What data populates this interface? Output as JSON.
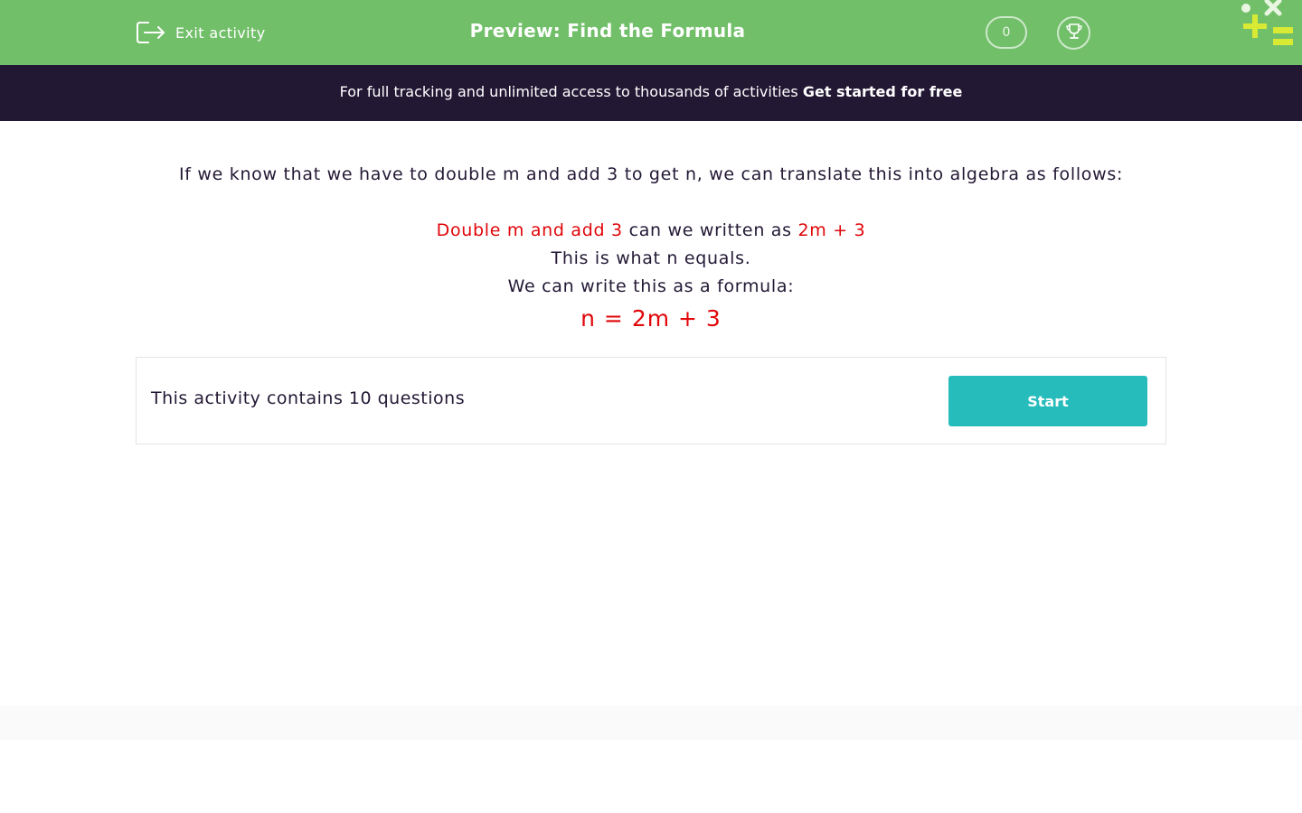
{
  "header": {
    "exit_label": "Exit activity",
    "title": "Preview: Find the Formula",
    "score": "0",
    "background": "#72bf6a"
  },
  "promo": {
    "text": "For full tracking and unlimited access to thousands of activities",
    "link": "Get started for free",
    "background": "#231834"
  },
  "explanation": {
    "intro": "If we know that we have to double m and add 3 to get n, we can translate this into algebra as follows:",
    "line1_red_a": "Double m and add 3",
    "line1_mid": "can we written as",
    "line1_red_b": "2m + 3",
    "line2": "This is what n equals.",
    "line3": "We can write this as a formula:",
    "formula": "n = 2m + 3",
    "highlight_color": "#e0060a"
  },
  "activity": {
    "summary": "This activity contains 10 questions",
    "start_label": "Start",
    "button_color": "#26bcbc"
  }
}
